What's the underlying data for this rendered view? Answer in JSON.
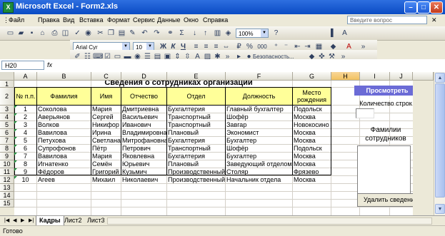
{
  "window": {
    "title": "Microsoft Excel - Form2.xls",
    "app_icon": "X"
  },
  "menu": [
    "Файл",
    "Правка",
    "Вид",
    "Вставка",
    "Формат",
    "Сервис",
    "Данные",
    "Окно",
    "Справка"
  ],
  "help_placeholder": "Введите вопрос",
  "toolbar": {
    "zoom": "100%",
    "font": "Arial Cyr",
    "size": "10",
    "bold": "Ж",
    "italic": "К",
    "underline": "Ч",
    "currency": "%",
    "thousands": "000",
    "security": "Безопасность..."
  },
  "formula_bar": {
    "name_box": "H20",
    "fx": "fx",
    "value": ""
  },
  "columns": [
    "A",
    "B",
    "C",
    "D",
    "E",
    "F",
    "G",
    "H",
    "I",
    "J"
  ],
  "selected_column": "H",
  "rows": [
    "1",
    "2",
    "3",
    "4",
    "5",
    "6",
    "7",
    "8",
    "9",
    "10",
    "11",
    "12",
    "13",
    "14",
    "15"
  ],
  "sheet": {
    "title": "Сведения о сотрудниках организации",
    "headers": [
      "№ п.п.",
      "Фамилия",
      "Имя",
      "Отчество",
      "Отдел",
      "Должность",
      "Место рождения"
    ],
    "records": [
      [
        "1",
        "Соколова",
        "Мария",
        "Дмитриевна",
        "Бухгалтерия",
        "Главный бухгалтер",
        "Подольск"
      ],
      [
        "2",
        "Аверьянов",
        "Сергей",
        "Васильевич",
        "Транспортный",
        "Шофёр",
        "Москва"
      ],
      [
        "3",
        "Волков",
        "Никифор",
        "Иванович",
        "Транспортный",
        "Завгар",
        "Новокосино"
      ],
      [
        "4",
        "Вавилова",
        "Ирина",
        "Владимировна",
        "Плановый",
        "Экономист",
        "Москва"
      ],
      [
        "5",
        "Петухова",
        "Светлана",
        "Митрофановна",
        "Бухгалтерия",
        "Бухгалтер",
        "Москва"
      ],
      [
        "6",
        "Супрофонов",
        "Пётр",
        "Петрович",
        "Транспортный",
        "Шофёр",
        "Подольск"
      ],
      [
        "7",
        "Вавилова",
        "Мария",
        "Яковлевна",
        "Бухгалтерия",
        "Бухгалтер",
        "Москва"
      ],
      [
        "8",
        "Игнатенко",
        "Семён",
        "Юрьевич",
        "Плановый",
        "Заведующий отделом",
        "Москва"
      ],
      [
        "9",
        "Фёдоров",
        "Григорий",
        "Кузьмич",
        "Производственный",
        "Столяр",
        "Фрязево"
      ],
      [
        "10",
        "Агеев",
        "Михаил",
        "Николаевич",
        "Производственный",
        "Начальник отдела",
        "Москва"
      ]
    ]
  },
  "controls": {
    "view_button": "Просмотреть список",
    "count_label": "Количество строк",
    "count_value": "",
    "list_label": "Фамилии сотрудников",
    "delete_button": "Удалить сведения"
  },
  "tabs": [
    "Кадры",
    "Лист2",
    "Лист3"
  ],
  "active_tab": "Кадры",
  "status": "Готово",
  "colors": {
    "title_bar": "#0A4BC4",
    "header_fill": "#FFFF99",
    "view_button": "#6B6BD6",
    "selected_header": "#F1C15F"
  }
}
